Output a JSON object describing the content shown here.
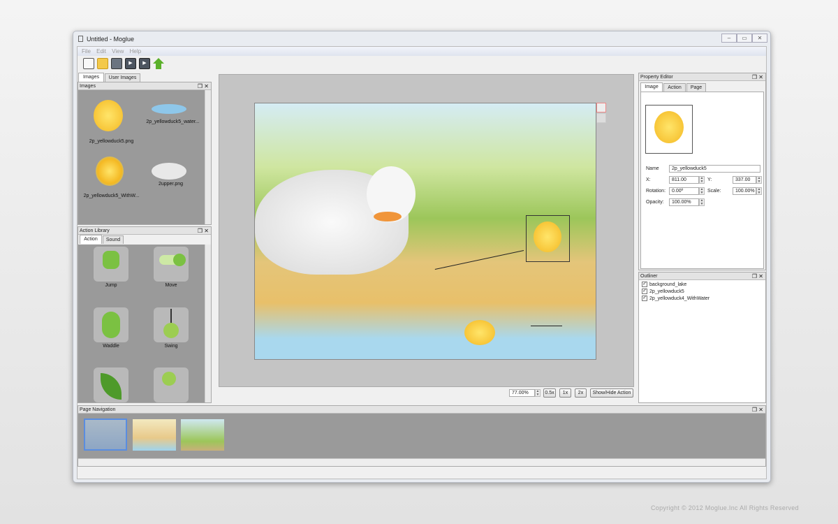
{
  "window": {
    "title": "Untitled - Moglue"
  },
  "menu": [
    "File",
    "Edit",
    "View",
    "Help"
  ],
  "toolbar": [
    "new-icon",
    "open-folder-icon",
    "save-icon",
    "preview-icon",
    "preview-device-icon",
    "upload-icon"
  ],
  "left_tabs": [
    "Images",
    "User Images"
  ],
  "images_dock": {
    "title": "Images",
    "items": [
      "2p_yellowduck5.png",
      "2p_yellowduck5_water...",
      "2p_yellowduck5_WithW...",
      "2upper.png"
    ]
  },
  "action_library": {
    "title": "Action Library",
    "tabs": [
      "Action",
      "Sound"
    ],
    "actions": [
      "Jump",
      "Move",
      "Waddle",
      "Swing",
      "",
      ""
    ]
  },
  "zoom": {
    "value": "77.00%",
    "buttons": [
      "0.5x",
      "1x",
      "2x",
      "Show/Hide Action"
    ]
  },
  "property_editor": {
    "title": "Property Editor",
    "tabs": [
      "Image",
      "Action",
      "Page"
    ],
    "name_label": "Name",
    "name": "2p_yellowduck5",
    "x_label": "X:",
    "x": "811.00",
    "y_label": "Y:",
    "y": "337.00",
    "rotation_label": "Rotation:",
    "rotation": "0.00º",
    "scale_label": "Scale:",
    "scale": "100.00%",
    "opacity_label": "Opacity:",
    "opacity": "100.00%"
  },
  "outliner": {
    "title": "Outliner",
    "items": [
      "background_lake",
      "2p_yellowduck5",
      "2p_yellowduck4_WithWater"
    ]
  },
  "page_navigation": {
    "title": "Page Navigation",
    "pages": 3
  },
  "copyright": "Copyright © 2012 Moglue.Inc All Rights Reserved"
}
